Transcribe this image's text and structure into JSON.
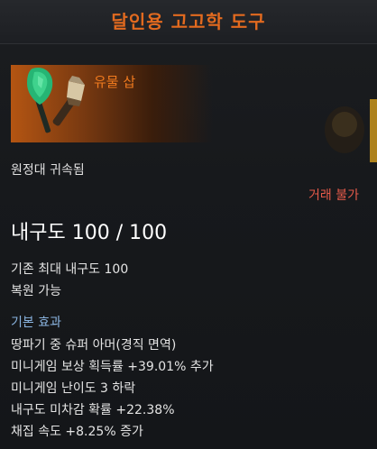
{
  "header": {
    "title": "달인용 고고학 도구"
  },
  "item": {
    "name": "유물 삽",
    "icon": "shovel-and-brush-icon",
    "bound": "원정대 귀속됨",
    "trade": "거래 불가"
  },
  "durability": {
    "label": "내구도 100 / 100"
  },
  "info": {
    "max_durability": "기존 최대 내구도 100",
    "repairable": "복원 가능"
  },
  "effects": {
    "title": "기본 효과",
    "lines": [
      "땅파기 중 슈퍼 아머(경직 면역)",
      "미니게임 보상 획득률 +39.01% 추가",
      "미니게임 난이도 3 하락",
      "내구도 미차감 확률 +22.38%",
      "채집 속도 +8.25% 증가"
    ]
  },
  "colors": {
    "title": "#e26a1f",
    "item_name": "#f07a1e",
    "trade_warning": "#e65a4a",
    "section_title": "#8ab4e0"
  }
}
